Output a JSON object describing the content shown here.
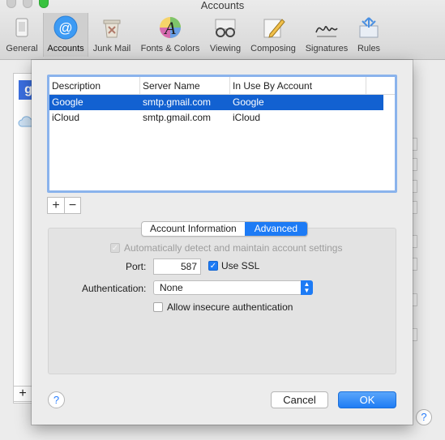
{
  "window": {
    "title": "Accounts"
  },
  "toolbar": {
    "items": [
      {
        "label": "General",
        "icon": "general-icon"
      },
      {
        "label": "Accounts",
        "icon": "at-sign-icon",
        "selected": true
      },
      {
        "label": "Junk Mail",
        "icon": "junk-mail-icon"
      },
      {
        "label": "Fonts & Colors",
        "icon": "fonts-colors-icon"
      },
      {
        "label": "Viewing",
        "icon": "viewing-glasses-icon"
      },
      {
        "label": "Composing",
        "icon": "composing-pencil-icon"
      },
      {
        "label": "Signatures",
        "icon": "signature-icon"
      },
      {
        "label": "Rules",
        "icon": "rules-icon"
      }
    ]
  },
  "background": {
    "plus_label": "+",
    "help_label": "?"
  },
  "table": {
    "columns": [
      "Description",
      "Server Name",
      "In Use By Account"
    ],
    "rows": [
      {
        "description": "Google",
        "server": "smtp.gmail.com",
        "account": "Google",
        "selected": true
      },
      {
        "description": "iCloud",
        "server": "smtp.gmail.com",
        "account": "iCloud",
        "selected": false
      }
    ],
    "add_label": "+",
    "remove_label": "−"
  },
  "tabs": {
    "items": [
      "Account Information",
      "Advanced"
    ],
    "active": "Advanced"
  },
  "advanced": {
    "auto_detect_label": "Automatically detect and maintain account settings",
    "auto_detect_checked": true,
    "auto_detect_enabled": false,
    "port_label": "Port:",
    "port_value": "587",
    "use_ssl_label": "Use SSL",
    "use_ssl_checked": true,
    "auth_label": "Authentication:",
    "auth_value": "None",
    "allow_insecure_label": "Allow insecure authentication",
    "allow_insecure_checked": false
  },
  "buttons": {
    "cancel": "Cancel",
    "ok": "OK",
    "help": "?"
  },
  "colors": {
    "accent": "#1d7bf5",
    "selection": "#1261d1",
    "focus_ring": "#8ab3ec"
  }
}
